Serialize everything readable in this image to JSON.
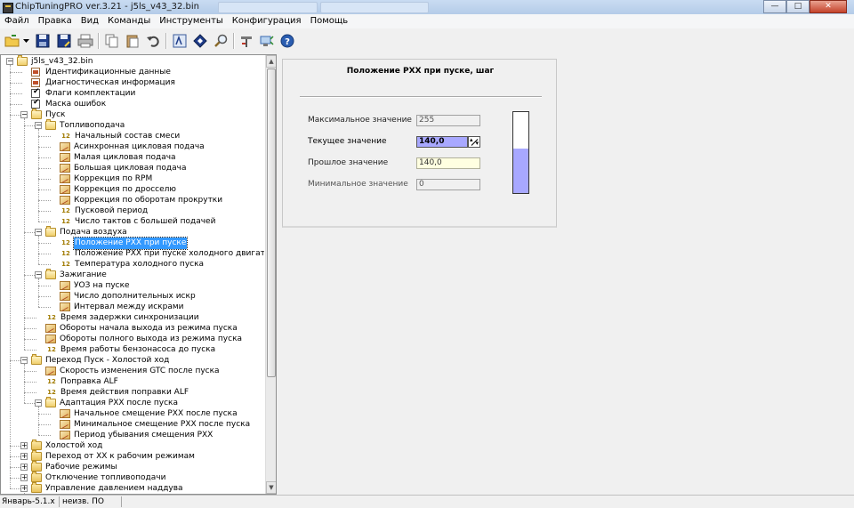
{
  "window": {
    "title": "ChipTuningPRO ver.3.21 - j5ls_v43_32.bin",
    "controls": [
      "minimize",
      "maximize",
      "close"
    ]
  },
  "menu": [
    "Файл",
    "Правка",
    "Вид",
    "Команды",
    "Инструменты",
    "Конфигурация",
    "Помощь"
  ],
  "toolbar": {
    "buttons": [
      {
        "icon": "open-folder-icon"
      },
      {
        "icon": "dropdown-arrow-icon"
      },
      {
        "icon": "save-icon"
      },
      {
        "icon": "save-as-icon"
      },
      {
        "icon": "print-icon"
      },
      {
        "icon": "copy-icon"
      },
      {
        "icon": "paste-icon"
      },
      {
        "icon": "undo-icon"
      },
      {
        "icon": "calculator-icon"
      },
      {
        "icon": "navigate-icon"
      },
      {
        "icon": "search-icon"
      },
      {
        "icon": "tools-icon"
      },
      {
        "icon": "connect-icon"
      },
      {
        "icon": "help-icon"
      }
    ]
  },
  "tree": {
    "items": [
      {
        "label": "j5ls_v43_32.bin",
        "depth": 0,
        "kind": "folder-open",
        "expander": "minus"
      },
      {
        "label": "Идентификационные данные",
        "depth": 1,
        "kind": "doc"
      },
      {
        "label": "Диагностическая информация",
        "depth": 1,
        "kind": "doc"
      },
      {
        "label": "Флаги комплектации",
        "depth": 1,
        "kind": "check"
      },
      {
        "label": "Маска ошибок",
        "depth": 1,
        "kind": "check"
      },
      {
        "label": "Пуск",
        "depth": 1,
        "kind": "folder-open",
        "expander": "minus"
      },
      {
        "label": "Топливоподача",
        "depth": 2,
        "kind": "folder-open",
        "expander": "minus"
      },
      {
        "label": "Начальный состав смеси",
        "depth": 3,
        "kind": "num"
      },
      {
        "label": "Асинхронная цикловая подача",
        "depth": 3,
        "kind": "map"
      },
      {
        "label": "Малая цикловая подача",
        "depth": 3,
        "kind": "map"
      },
      {
        "label": "Большая цикловая подача",
        "depth": 3,
        "kind": "map"
      },
      {
        "label": "Коррекция по RPM",
        "depth": 3,
        "kind": "map"
      },
      {
        "label": "Коррекция по дросселю",
        "depth": 3,
        "kind": "map"
      },
      {
        "label": "Коррекция по оборотам прокрутки",
        "depth": 3,
        "kind": "map"
      },
      {
        "label": "Пусковой период",
        "depth": 3,
        "kind": "num"
      },
      {
        "label": "Число тактов с большей подачей",
        "depth": 3,
        "kind": "num"
      },
      {
        "label": "Подача воздуха",
        "depth": 2,
        "kind": "folder-open",
        "expander": "minus"
      },
      {
        "label": "Положение РХХ при пуске",
        "depth": 3,
        "kind": "num",
        "selected": true
      },
      {
        "label": "Положение РХХ при пуске холодного двигателя",
        "depth": 3,
        "kind": "num"
      },
      {
        "label": "Температура холодного пуска",
        "depth": 3,
        "kind": "num"
      },
      {
        "label": "Зажигание",
        "depth": 2,
        "kind": "folder-open",
        "expander": "minus"
      },
      {
        "label": "УОЗ на пуске",
        "depth": 3,
        "kind": "map"
      },
      {
        "label": "Число дополнительных искр",
        "depth": 3,
        "kind": "map"
      },
      {
        "label": "Интервал между искрами",
        "depth": 3,
        "kind": "map"
      },
      {
        "label": "Время задержки синхронизации",
        "depth": 2,
        "kind": "num"
      },
      {
        "label": "Обороты начала выхода из режима пуска",
        "depth": 2,
        "kind": "map"
      },
      {
        "label": "Обороты полного выхода из режима пуска",
        "depth": 2,
        "kind": "map"
      },
      {
        "label": "Время работы бензонасоса до пуска",
        "depth": 2,
        "kind": "num"
      },
      {
        "label": "Переход Пуск - Холостой ход",
        "depth": 1,
        "kind": "folder-open",
        "expander": "minus"
      },
      {
        "label": "Скорость изменения GTC после пуска",
        "depth": 2,
        "kind": "map"
      },
      {
        "label": "Поправка ALF",
        "depth": 2,
        "kind": "num"
      },
      {
        "label": "Время действия поправки ALF",
        "depth": 2,
        "kind": "num"
      },
      {
        "label": "Адаптация РХХ после пуска",
        "depth": 2,
        "kind": "folder-open",
        "expander": "minus"
      },
      {
        "label": "Начальное смещение РХХ после пуска",
        "depth": 3,
        "kind": "map"
      },
      {
        "label": "Минимальное смещение РХХ после пуска",
        "depth": 3,
        "kind": "map"
      },
      {
        "label": "Период убывания смещения РХХ",
        "depth": 3,
        "kind": "map"
      },
      {
        "label": "Холостой ход",
        "depth": 1,
        "kind": "folder",
        "expander": "plus"
      },
      {
        "label": "Переход от ХХ к рабочим режимам",
        "depth": 1,
        "kind": "folder",
        "expander": "plus"
      },
      {
        "label": "Рабочие режимы",
        "depth": 1,
        "kind": "folder",
        "expander": "plus"
      },
      {
        "label": "Отключение топливоподачи",
        "depth": 1,
        "kind": "folder",
        "expander": "plus"
      },
      {
        "label": "Управление давлением наддува",
        "depth": 1,
        "kind": "folder",
        "expander": "plus"
      }
    ],
    "num_icon_text": "12"
  },
  "parameter": {
    "title": "Положение РХХ при пуске, шаг",
    "max_label": "Максимальное значение",
    "max_value": "255",
    "current_label": "Текущее значение",
    "current_value": "140,0",
    "previous_label": "Прошлое значение",
    "previous_value": "140,0",
    "min_label": "Минимальное значение",
    "min_value": "0",
    "gauge_fraction": 0.549,
    "gauge_color": "#a8a8ff"
  },
  "status": {
    "cell1": "Январь-5.1.x",
    "cell2": "неизв. ПО"
  }
}
